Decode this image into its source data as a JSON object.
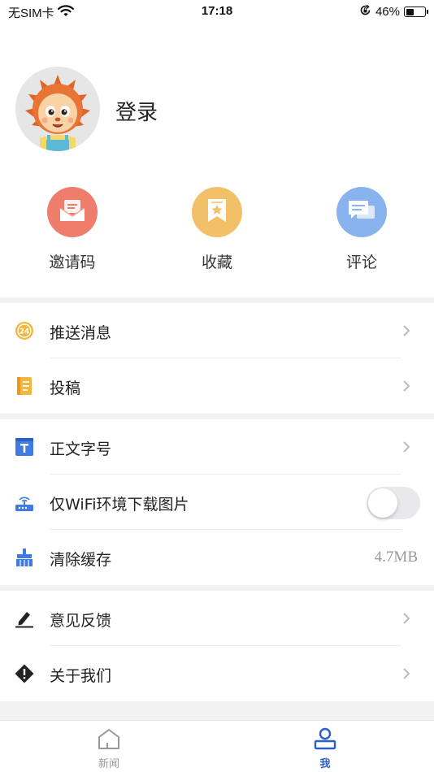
{
  "status_bar": {
    "carrier": "无SIM卡",
    "time": "17:18",
    "battery": "46%",
    "battery_level": 0.46
  },
  "profile": {
    "login_label": "登录"
  },
  "quick_actions": [
    {
      "label": "邀请码",
      "icon": "envelope-icon",
      "color": "#ee7d6c"
    },
    {
      "label": "收藏",
      "icon": "bookmark-icon",
      "color": "#f3c06a"
    },
    {
      "label": "评论",
      "icon": "comment-icon",
      "color": "#88b3ef"
    }
  ],
  "menu": {
    "push": "推送消息",
    "submit": "投稿",
    "font_size": "正文字号",
    "wifi_only": "仅WiFi环境下载图片",
    "wifi_only_enabled": false,
    "clear_cache": "清除缓存",
    "cache_size": "4.7MB",
    "feedback": "意见反馈",
    "about": "关于我们"
  },
  "tabbar": {
    "news": "新闻",
    "me": "我",
    "active": "me",
    "active_color": "#2b5fcc",
    "inactive_color": "#999999"
  }
}
